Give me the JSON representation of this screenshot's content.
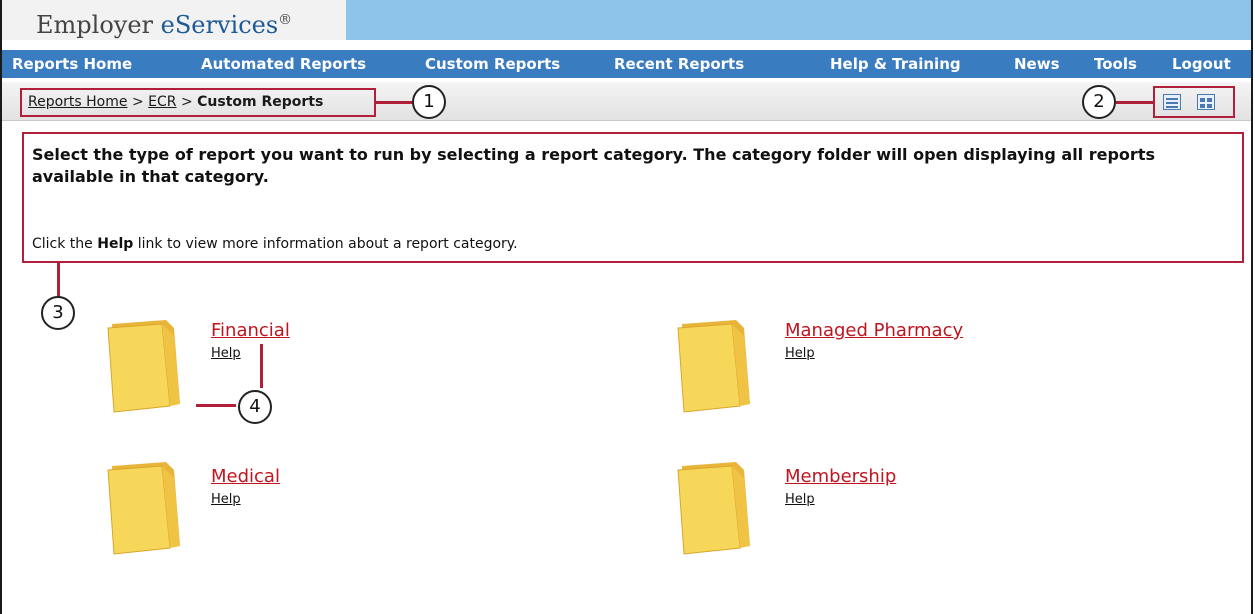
{
  "app": {
    "title_part1": "Employer ",
    "title_part2": "eServices",
    "title_mark": "®"
  },
  "nav": {
    "items": [
      {
        "label": "Reports Home"
      },
      {
        "label": "Automated Reports"
      },
      {
        "label": "Custom Reports"
      },
      {
        "label": "Recent Reports"
      },
      {
        "label": "Help & Training"
      },
      {
        "label": "News"
      },
      {
        "label": "Tools"
      },
      {
        "label": "Logout"
      }
    ]
  },
  "breadcrumb": {
    "home": "Reports Home",
    "sep": ">",
    "ecr": "ECR",
    "current": "Custom Reports"
  },
  "callouts": {
    "c1": "1",
    "c2": "2",
    "c3": "3",
    "c4": "4"
  },
  "view_icons": [
    {
      "icon": "list-view-icon"
    },
    {
      "icon": "grid-view-icon"
    }
  ],
  "instructions": {
    "main": "Select the type of report you want to run by selecting a report category.  The category folder will open displaying all reports available in that category.",
    "help_prefix": "Click the ",
    "help_bold": "Help",
    "help_suffix": " link to view more information about a report category."
  },
  "categories": [
    {
      "title": "Financial",
      "help": "Help"
    },
    {
      "title": "Managed Pharmacy",
      "help": "Help"
    },
    {
      "title": "Medical",
      "help": "Help"
    },
    {
      "title": "Membership",
      "help": "Help"
    }
  ],
  "colors": {
    "nav_bg": "#3a7cc0",
    "title_band": "#8ec3ea",
    "highlight": "#b0203a",
    "link_red": "#c0141e"
  }
}
